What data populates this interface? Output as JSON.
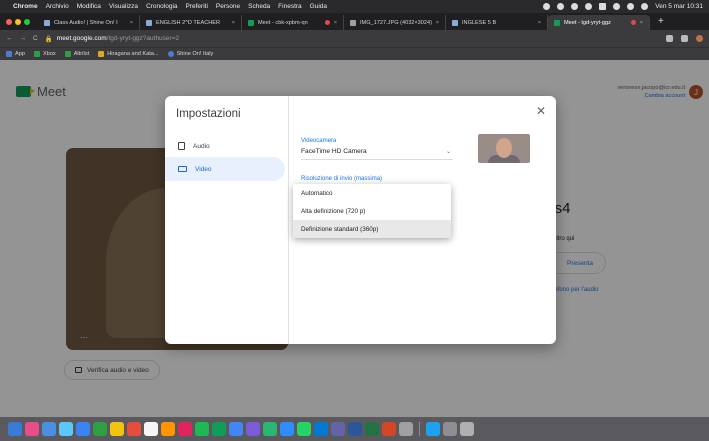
{
  "menubar": {
    "items": [
      "Chrome",
      "Archivio",
      "Modifica",
      "Visualizza",
      "Cronologia",
      "Preferiti",
      "Persone",
      "Scheda",
      "Finestra",
      "Guida"
    ],
    "clock": "Ven 5 mar 10:31"
  },
  "tabs": [
    {
      "label": "Class Audio! | Shine On! I",
      "active": false
    },
    {
      "label": "ENGLISH 2^D TEACHER",
      "active": false
    },
    {
      "label": "Meet - cbk-xpbm-qn",
      "active": false,
      "recording": true
    },
    {
      "label": "IMG_1727.JPG (4032×3024)",
      "active": false
    },
    {
      "label": "INGLESE 5 B",
      "active": false
    },
    {
      "label": "Meet - tgd-yryt-ggz",
      "active": true,
      "recording": true
    }
  ],
  "address": {
    "host": "meet.google.com",
    "path": "/tgd-yryt-ggz?authuser=2"
  },
  "bookmarks": [
    {
      "label": "App",
      "color": "#4f7ad6"
    },
    {
      "label": "Xbox",
      "color": "#2f9e44"
    },
    {
      "label": "AltriIst",
      "color": "#2f9e44"
    },
    {
      "label": "Hiragana and Kata...",
      "color": "#e0a526"
    },
    {
      "label": "Shine On! Italy",
      "color": "#4f7ad6"
    }
  ],
  "meet": {
    "logo_text": "Meet",
    "account_email": "veronese.jacopo@icr.edu.it",
    "account_link": "Cambia account",
    "avatar_letter": "J",
    "verify_label": "Verifica audio e video",
    "side_title": "ejs4",
    "side_text": "altro qui",
    "present_label": "Presenta",
    "phone_link": "lefono per l'audio",
    "dots": "..."
  },
  "settings": {
    "title": "Impostazioni",
    "nav": [
      {
        "label": "Audio",
        "icon": "speaker-icon"
      },
      {
        "label": "Video",
        "icon": "camera-icon",
        "selected": true
      }
    ],
    "close_glyph": "✕",
    "camera_label": "Videocamera",
    "camera_value": "FaceTime HD Camera",
    "resolution_label": "Risoluzione di invio (massima)",
    "resolution_options": [
      "Automatico",
      "Alta definizione (720 p)",
      "Definizione standard (360p)"
    ],
    "resolution_selected_index": 2
  },
  "colors": {
    "accent": "#1a73e8",
    "nav_selected_bg": "#e8f0fe",
    "menubar_bg": "#2a2a2c",
    "dock_bg": "#5a5a5e"
  }
}
